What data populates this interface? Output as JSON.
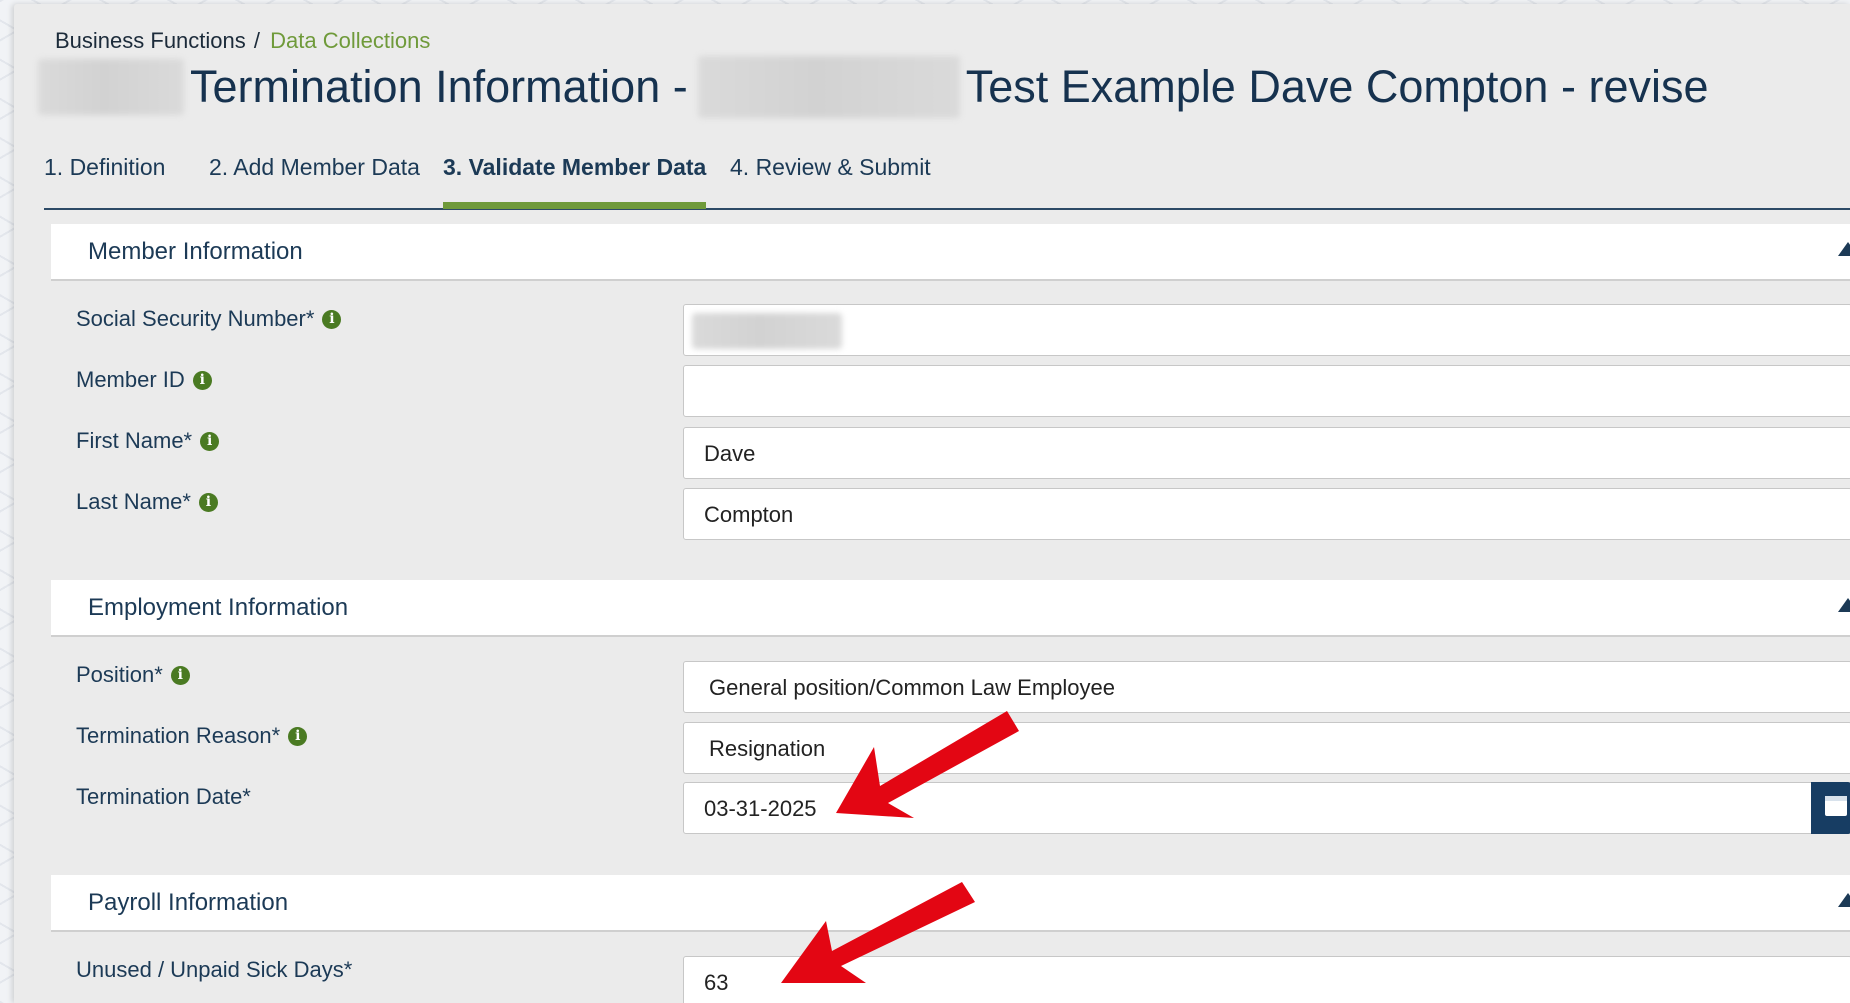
{
  "breadcrumb": {
    "parent": "Business Functions",
    "separator": "/",
    "current": "Data Collections"
  },
  "title": {
    "part1": "Termination Information -",
    "part2": "Test Example Dave Compton - revise"
  },
  "tabs": [
    {
      "label": "1. Definition",
      "active": false
    },
    {
      "label": "2. Add Member Data",
      "active": false
    },
    {
      "label": "3. Validate Member Data",
      "active": true
    },
    {
      "label": "4. Review & Submit",
      "active": false
    }
  ],
  "member_info": {
    "heading": "Member Information",
    "fields": {
      "ssn": {
        "label": "Social Security Number*",
        "value": ""
      },
      "member_id": {
        "label": "Member ID",
        "value": ""
      },
      "first_name": {
        "label": "First Name*",
        "value": "Dave"
      },
      "last_name": {
        "label": "Last Name*",
        "value": "Compton"
      }
    }
  },
  "employment_info": {
    "heading": "Employment Information",
    "fields": {
      "position": {
        "label": "Position*",
        "value": "General position/Common Law Employee"
      },
      "termination_reason": {
        "label": "Termination Reason*",
        "value": "Resignation"
      },
      "termination_date": {
        "label": "Termination Date*",
        "value": "03-31-2025"
      }
    }
  },
  "payroll_info": {
    "heading": "Payroll Information",
    "fields": {
      "sick_days": {
        "label": "Unused / Unpaid Sick Days*",
        "value": "63"
      }
    }
  },
  "colors": {
    "accent": "#6f9a3a",
    "navy": "#173d63",
    "annotation": "#e30613"
  },
  "icons": [
    "info-icon",
    "caret-up-icon",
    "calendar-icon",
    "annotation-arrow"
  ]
}
